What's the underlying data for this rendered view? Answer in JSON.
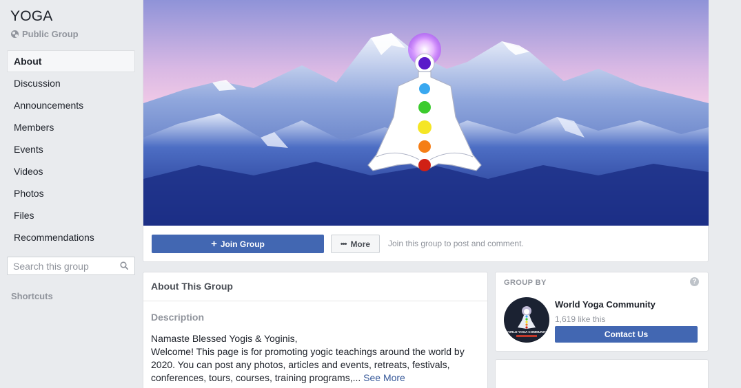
{
  "group": {
    "title": "YOGA",
    "privacy": "Public Group"
  },
  "sidebar": {
    "items": [
      {
        "label": "About",
        "active": true
      },
      {
        "label": "Discussion"
      },
      {
        "label": "Announcements"
      },
      {
        "label": "Members"
      },
      {
        "label": "Events"
      },
      {
        "label": "Videos"
      },
      {
        "label": "Photos"
      },
      {
        "label": "Files"
      },
      {
        "label": "Recommendations"
      }
    ],
    "search_placeholder": "Search this group",
    "shortcuts_label": "Shortcuts"
  },
  "cover": {
    "image": "mountain-range-with-meditating-figure-and-chakras"
  },
  "actions": {
    "join_label": "Join Group",
    "more_label": "More",
    "hint": "Join this group to post and comment."
  },
  "about": {
    "header": "About This Group",
    "description_label": "Description",
    "lines": [
      "Namaste Blessed Yogis & Yoginis,",
      "Welcome! This page is for promoting yogic teachings around the world by",
      "2020. You can post any photos, articles and events, retreats, festivals,",
      "conferences, tours, courses, training programs,..."
    ],
    "see_more": "See More"
  },
  "group_by": {
    "label": "GROUP BY",
    "help_icon": "?",
    "page_name": "World Yoga Community",
    "likes": "1,619 like this",
    "contact_label": "Contact Us",
    "avatar_text": "WORLD YOGA COMMUNITY"
  },
  "colors": {
    "primary": "#4267b2",
    "link": "#365899",
    "background": "#e9ebee",
    "muted": "#90949c"
  }
}
